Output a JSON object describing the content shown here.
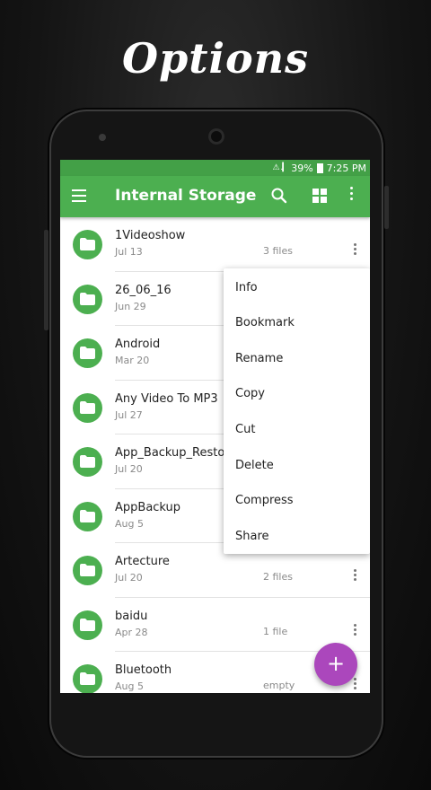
{
  "promo": {
    "title": "Options"
  },
  "status_bar": {
    "signal": "⚠ .▎",
    "battery": "39%",
    "time": "7:25 PM"
  },
  "app_bar": {
    "title": "Internal Storage"
  },
  "files": [
    {
      "name": "1Videoshow",
      "date": "Jul 13",
      "count": "3 files"
    },
    {
      "name": "26_06_16",
      "date": "Jun 29",
      "count": ""
    },
    {
      "name": "Android",
      "date": "Mar 20",
      "count": ""
    },
    {
      "name": "Any Video To MP3",
      "date": "Jul 27",
      "count": ""
    },
    {
      "name": "App_Backup_Restore",
      "date": "Jul 20",
      "count": ""
    },
    {
      "name": "AppBackup",
      "date": "Aug 5",
      "count": ""
    },
    {
      "name": "Artecture",
      "date": "Jul 20",
      "count": "2 files"
    },
    {
      "name": "baidu",
      "date": "Apr 28",
      "count": "1 file"
    },
    {
      "name": "Bluetooth",
      "date": "Aug 5",
      "count": "empty"
    }
  ],
  "menu": {
    "items": [
      "Info",
      "Bookmark",
      "Rename",
      "Copy",
      "Cut",
      "Delete",
      "Compress",
      "Share"
    ]
  },
  "fab": {
    "label": "+"
  },
  "colors": {
    "primary": "#4caf50",
    "status": "#43a047",
    "accent": "#ab47bc"
  }
}
